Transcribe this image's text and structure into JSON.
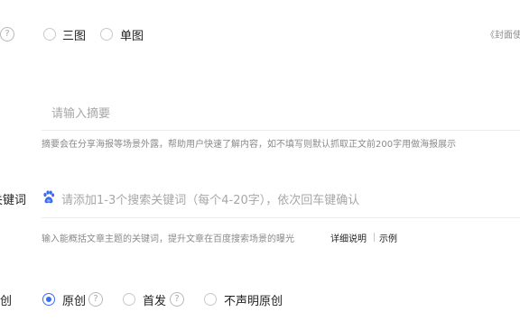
{
  "cover": {
    "options": [
      {
        "label": "三图",
        "selected": false
      },
      {
        "label": "单图",
        "selected": false
      }
    ],
    "side_tag": "《封面使"
  },
  "summary": {
    "placeholder": "请输入摘要",
    "hint": "摘要会在分享海报等场景外露，帮助用户快速了解内容，如不填写则默认抓取正文前200字用做海报展示"
  },
  "keywords": {
    "label": "关键词",
    "placeholder": "请添加1-3个搜索关键词（每个4-20字），依次回车键确认",
    "hint": "输入能概括文章主题的关键词，提升文章在百度搜索场景的曝光",
    "detail_link": "详细说明",
    "example_link": "示例",
    "icon": "baidu-paw-icon",
    "icon_color": "#3b6cf0"
  },
  "originality": {
    "label": "原创",
    "options": [
      {
        "label": "原创",
        "selected": true,
        "has_help": true
      },
      {
        "label": "首发",
        "selected": false,
        "has_help": true
      },
      {
        "label": "不声明原创",
        "selected": false,
        "has_help": false
      }
    ],
    "accent": "#3a6cf5"
  }
}
